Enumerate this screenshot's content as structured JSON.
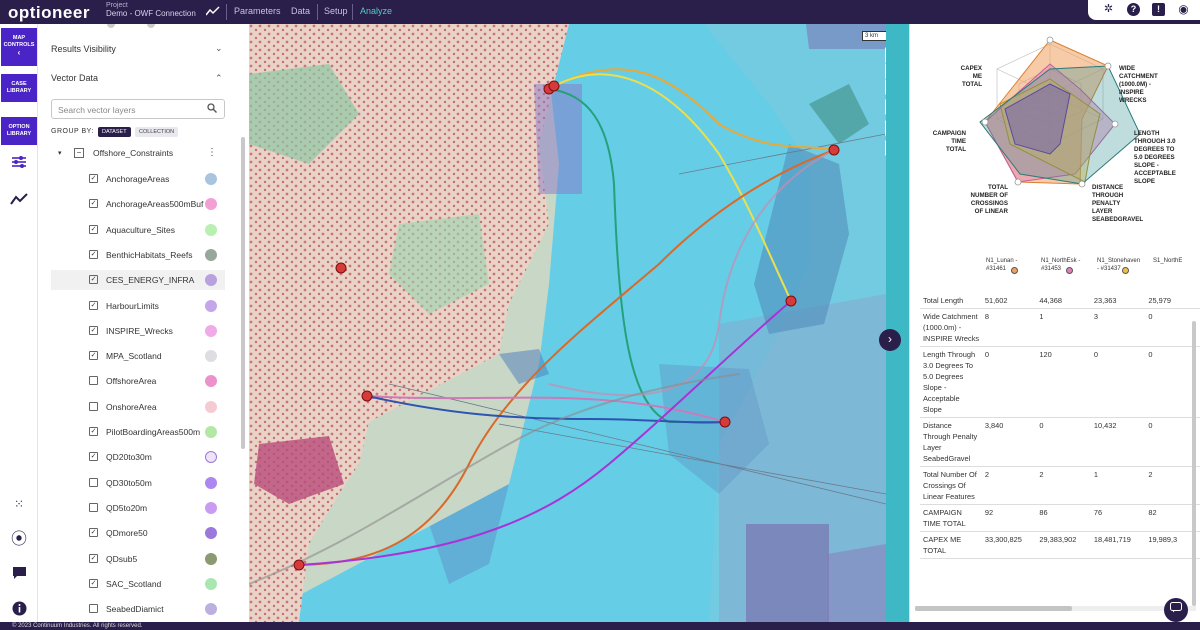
{
  "app": {
    "logo": "optioneer",
    "project_label": "Project",
    "project_name": "Demo - OWF Connection"
  },
  "nav": [
    {
      "label": "Parameters"
    },
    {
      "label": "Data"
    },
    {
      "label": "Setup"
    },
    {
      "label": "Analyze",
      "active": true
    }
  ],
  "rail": {
    "map_controls": "MAP CONTROLS",
    "map_controls_arrow": "‹",
    "case_library": "CASE LIBRARY",
    "option_library": "OPTION LIBRARY"
  },
  "panel": {
    "results_visibility": "Results Visibility",
    "vector_data": "Vector Data",
    "search_placeholder": "Search vector layers",
    "group_by": "GROUP BY:",
    "group_dataset": "DATASET",
    "group_collection": "COLLECTION",
    "root_group": "Offshore_Constraints",
    "layers": [
      {
        "name": "AnchorageAreas",
        "checked": true,
        "color": "#a9c4df"
      },
      {
        "name": "AnchorageAreas500mBuf",
        "checked": true,
        "color": "#f39fd6"
      },
      {
        "name": "Aquaculture_Sites",
        "checked": true,
        "color": "#b7f0b0"
      },
      {
        "name": "BenthicHabitats_Reefs",
        "checked": true,
        "color": "#97a79b"
      },
      {
        "name": "CES_ENERGY_INFRA",
        "checked": true,
        "color": "#b9a0df",
        "highlight": true
      },
      {
        "name": "HarbourLimits",
        "checked": true,
        "color": "#c4a6e9"
      },
      {
        "name": "INSPIRE_Wrecks",
        "checked": true,
        "color": "#f0aae8"
      },
      {
        "name": "MPA_Scotland",
        "checked": true,
        "color": "#dedde2"
      },
      {
        "name": "OffshoreArea",
        "checked": false,
        "color": "#ec91cc"
      },
      {
        "name": "OnshoreArea",
        "checked": false,
        "color": "#f6cad2"
      },
      {
        "name": "PilotBoardingAreas500m",
        "checked": true,
        "color": "#b2e8a4"
      },
      {
        "name": "QD20to30m",
        "checked": true,
        "color": "#efe3f8"
      },
      {
        "name": "QD30to50m",
        "checked": false,
        "color": "#ad86ef"
      },
      {
        "name": "QD5to20m",
        "checked": false,
        "color": "#c99cf2"
      },
      {
        "name": "QDmore50",
        "checked": true,
        "color": "#9b78dc"
      },
      {
        "name": "QDsub5",
        "checked": true,
        "color": "#8b9a70"
      },
      {
        "name": "SAC_Scotland",
        "checked": true,
        "color": "#a9e7b0"
      },
      {
        "name": "SeabedDiamict",
        "checked": false,
        "color": "#bbb0e0"
      }
    ]
  },
  "map": {
    "scale": "3 km"
  },
  "radar": {
    "axes": [
      "CAPEX ME TOTAL",
      "WIDE CATCHMENT (1000.0M) - INSPIRE WRECKS",
      "LENGTH THROUGH 3.0 DEGREES TO 5.0 DEGREES SLOPE - ACCEPTABLE SLOPE",
      "DISTANCE THROUGH PENALTY LAYER SEABEDGRAVEL",
      "TOTAL NUMBER OF CROSSINGS OF LINEAR",
      "CAMPAIGN TIME TOTAL"
    ],
    "options": [
      {
        "name": "N1_Lunan - #31461",
        "color": "#f0a060"
      },
      {
        "name": "N1_NorthEsk - #31453",
        "color": "#e07fb8"
      },
      {
        "name": "N1_Stonehaven - #31437",
        "color": "#f0c040"
      },
      {
        "name": "S1_NorthE",
        "color": "#3050c0"
      }
    ]
  },
  "metrics": [
    {
      "label": "Total Length",
      "values": [
        "51,602",
        "44,368",
        "23,363",
        "25,979"
      ]
    },
    {
      "label": "Wide Catchment (1000.0m) - INSPIRE Wrecks",
      "values": [
        "8",
        "1",
        "3",
        "0"
      ]
    },
    {
      "label": "Length Through 3.0 Degrees To 5.0 Degrees Slope - Acceptable Slope",
      "values": [
        "0",
        "120",
        "0",
        "0"
      ]
    },
    {
      "label": "Distance Through Penalty Layer SeabedGravel",
      "values": [
        "3,840",
        "0",
        "10,432",
        "0"
      ]
    },
    {
      "label": "Total Number Of Crossings Of Linear Features",
      "values": [
        "2",
        "2",
        "1",
        "2"
      ]
    },
    {
      "label": "CAMPAIGN TIME TOTAL",
      "values": [
        "92",
        "86",
        "76",
        "82"
      ]
    },
    {
      "label": "CAPEX ME TOTAL",
      "values": [
        "33,300,825",
        "29,383,902",
        "18,481,719",
        "19,989,3"
      ]
    }
  ],
  "footer": "© 2023 Continuum Industries. All rights reserved."
}
